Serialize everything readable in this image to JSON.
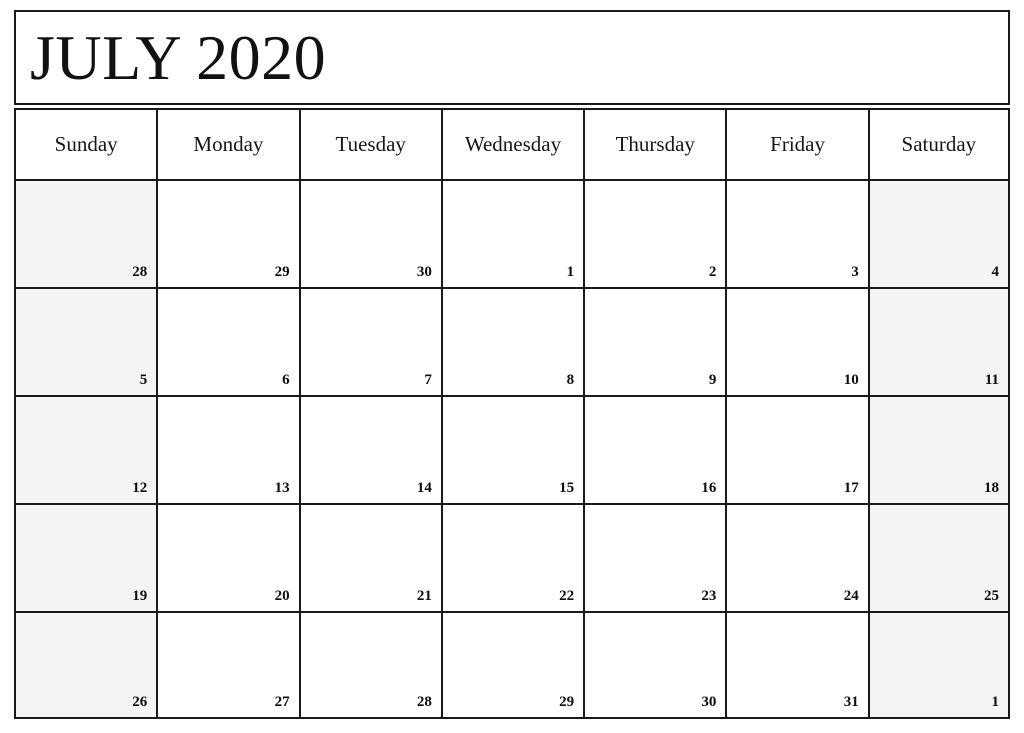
{
  "document": {
    "type": "printable-monthly-calendar",
    "title": "JULY 2020",
    "month": "JULY",
    "year": "2020"
  },
  "colors": {
    "border": "#1a1a1a",
    "weekend_background": "#f4f4f4",
    "weekday_background": "#ffffff",
    "text": "#111111",
    "page_background": "#ffffff"
  },
  "header": {
    "days": [
      {
        "label": "Sunday",
        "short": "sun",
        "weekend": true
      },
      {
        "label": "Monday",
        "short": "mon",
        "weekend": false
      },
      {
        "label": "Tuesday",
        "short": "tue",
        "weekend": false
      },
      {
        "label": "Wednesday",
        "short": "wed",
        "weekend": false
      },
      {
        "label": "Thursday",
        "short": "thu",
        "weekend": false
      },
      {
        "label": "Friday",
        "short": "fri",
        "weekend": false
      },
      {
        "label": "Saturday",
        "short": "sat",
        "weekend": true
      }
    ]
  },
  "weeks": [
    {
      "index": 1,
      "days": [
        {
          "number": "28",
          "in_month": false
        },
        {
          "number": "29",
          "in_month": false
        },
        {
          "number": "30",
          "in_month": false
        },
        {
          "number": "1",
          "in_month": true
        },
        {
          "number": "2",
          "in_month": true
        },
        {
          "number": "3",
          "in_month": true
        },
        {
          "number": "4",
          "in_month": true
        }
      ]
    },
    {
      "index": 2,
      "days": [
        {
          "number": "5",
          "in_month": true
        },
        {
          "number": "6",
          "in_month": true
        },
        {
          "number": "7",
          "in_month": true
        },
        {
          "number": "8",
          "in_month": true
        },
        {
          "number": "9",
          "in_month": true
        },
        {
          "number": "10",
          "in_month": true
        },
        {
          "number": "11",
          "in_month": true
        }
      ]
    },
    {
      "index": 3,
      "days": [
        {
          "number": "12",
          "in_month": true
        },
        {
          "number": "13",
          "in_month": true
        },
        {
          "number": "14",
          "in_month": true
        },
        {
          "number": "15",
          "in_month": true
        },
        {
          "number": "16",
          "in_month": true
        },
        {
          "number": "17",
          "in_month": true
        },
        {
          "number": "18",
          "in_month": true
        }
      ]
    },
    {
      "index": 4,
      "days": [
        {
          "number": "19",
          "in_month": true
        },
        {
          "number": "20",
          "in_month": true
        },
        {
          "number": "21",
          "in_month": true
        },
        {
          "number": "22",
          "in_month": true
        },
        {
          "number": "23",
          "in_month": true
        },
        {
          "number": "24",
          "in_month": true
        },
        {
          "number": "25",
          "in_month": true
        }
      ]
    },
    {
      "index": 5,
      "days": [
        {
          "number": "26",
          "in_month": true
        },
        {
          "number": "27",
          "in_month": true
        },
        {
          "number": "28",
          "in_month": true
        },
        {
          "number": "29",
          "in_month": true
        },
        {
          "number": "30",
          "in_month": true
        },
        {
          "number": "31",
          "in_month": true
        },
        {
          "number": "1",
          "in_month": false
        }
      ]
    }
  ],
  "footer": {
    "clipped_text": "· · · · ·"
  }
}
